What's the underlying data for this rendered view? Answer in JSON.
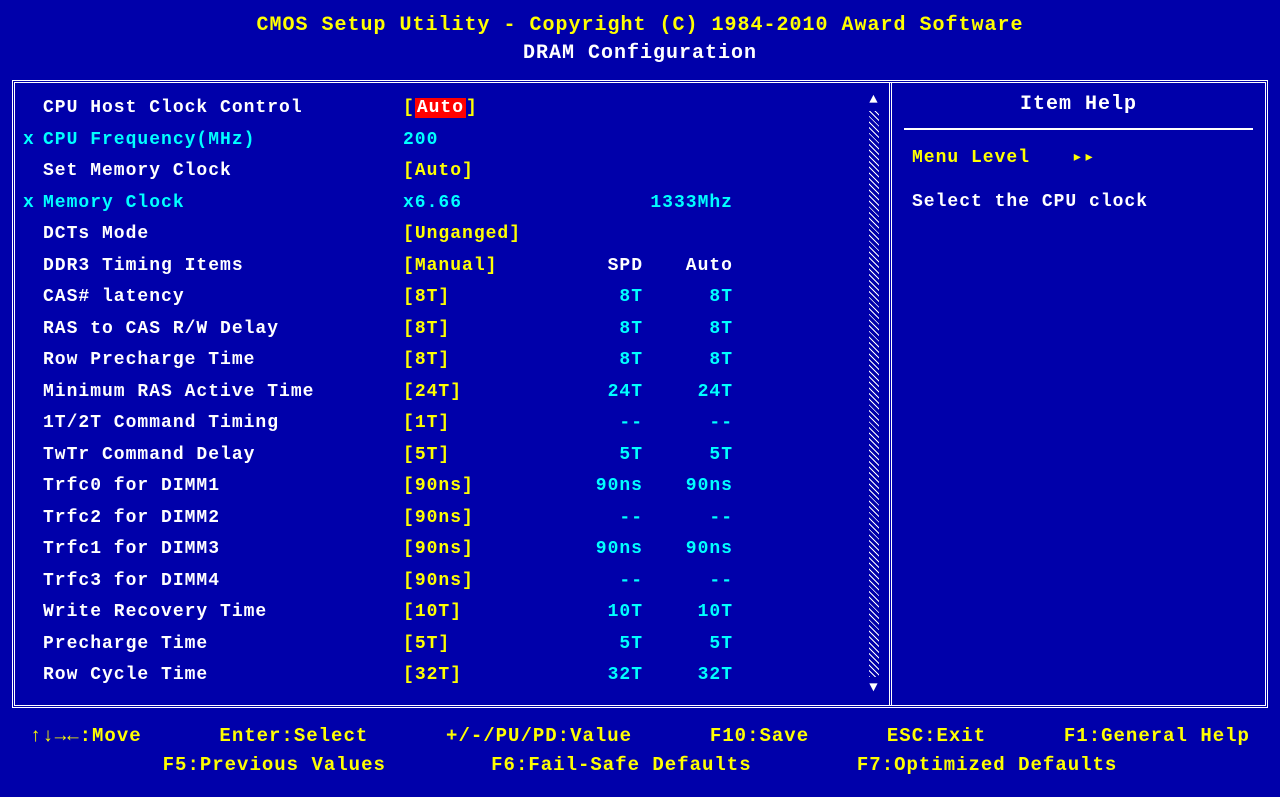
{
  "header": {
    "title1": "CMOS Setup Utility - Copyright (C) 1984-2010 Award Software",
    "title2": "DRAM Configuration"
  },
  "help": {
    "title": "Item Help",
    "menu_level_label": "Menu Level",
    "menu_level_arrows": "▸▸",
    "text": "Select the CPU clock"
  },
  "columns": {
    "spd": "SPD",
    "auto": "Auto"
  },
  "settings": [
    {
      "marker": "",
      "label": "CPU Host Clock Control",
      "value": "Auto",
      "bracketed": true,
      "highlight": true,
      "spd": "",
      "auto": "",
      "labelColor": "white",
      "valColor": "white"
    },
    {
      "marker": "x",
      "label": "CPU Frequency(MHz)",
      "value": "200",
      "bracketed": false,
      "highlight": false,
      "spd": "",
      "auto": "",
      "labelColor": "cyan",
      "valColor": "cyan"
    },
    {
      "marker": "",
      "label": "Set Memory Clock",
      "value": "Auto",
      "bracketed": true,
      "highlight": false,
      "spd": "",
      "auto": "",
      "labelColor": "white",
      "valColor": "yellow"
    },
    {
      "marker": "x",
      "label": "Memory Clock",
      "value": "x6.66",
      "bracketed": false,
      "highlight": false,
      "spd": "",
      "auto": "1333Mhz",
      "labelColor": "cyan",
      "valColor": "cyan"
    },
    {
      "marker": "",
      "label": "DCTs Mode",
      "value": "Unganged",
      "bracketed": true,
      "highlight": false,
      "spd": "",
      "auto": "",
      "labelColor": "white",
      "valColor": "yellow"
    },
    {
      "marker": "",
      "label": "DDR3 Timing Items",
      "value": "Manual",
      "bracketed": true,
      "highlight": false,
      "spd": "SPD",
      "auto": "Auto",
      "labelColor": "white",
      "valColor": "yellow",
      "header": true
    },
    {
      "marker": "",
      "label": "CAS# latency",
      "value": "8T",
      "bracketed": true,
      "highlight": false,
      "spd": "8T",
      "auto": "8T",
      "labelColor": "white",
      "valColor": "yellow"
    },
    {
      "marker": "",
      "label": "RAS to CAS R/W Delay",
      "value": "8T",
      "bracketed": true,
      "highlight": false,
      "spd": "8T",
      "auto": "8T",
      "labelColor": "white",
      "valColor": "yellow"
    },
    {
      "marker": "",
      "label": "Row Precharge Time",
      "value": "8T",
      "bracketed": true,
      "highlight": false,
      "spd": "8T",
      "auto": "8T",
      "labelColor": "white",
      "valColor": "yellow"
    },
    {
      "marker": "",
      "label": "Minimum RAS Active Time",
      "value": "24T",
      "bracketed": true,
      "highlight": false,
      "spd": "24T",
      "auto": "24T",
      "labelColor": "white",
      "valColor": "yellow"
    },
    {
      "marker": "",
      "label": "1T/2T Command Timing",
      "value": "1T",
      "bracketed": true,
      "highlight": false,
      "spd": "--",
      "auto": "--",
      "labelColor": "white",
      "valColor": "yellow"
    },
    {
      "marker": "",
      "label": "TwTr Command Delay",
      "value": "5T",
      "bracketed": true,
      "highlight": false,
      "spd": "5T",
      "auto": "5T",
      "labelColor": "white",
      "valColor": "yellow"
    },
    {
      "marker": "",
      "label": "Trfc0 for DIMM1",
      "value": "90ns",
      "bracketed": true,
      "highlight": false,
      "spd": "90ns",
      "auto": "90ns",
      "labelColor": "white",
      "valColor": "yellow"
    },
    {
      "marker": "",
      "label": "Trfc2 for DIMM2",
      "value": "90ns",
      "bracketed": true,
      "highlight": false,
      "spd": "--",
      "auto": "--",
      "labelColor": "white",
      "valColor": "yellow"
    },
    {
      "marker": "",
      "label": "Trfc1 for DIMM3",
      "value": "90ns",
      "bracketed": true,
      "highlight": false,
      "spd": "90ns",
      "auto": "90ns",
      "labelColor": "white",
      "valColor": "yellow"
    },
    {
      "marker": "",
      "label": "Trfc3 for DIMM4",
      "value": "90ns",
      "bracketed": true,
      "highlight": false,
      "spd": "--",
      "auto": "--",
      "labelColor": "white",
      "valColor": "yellow"
    },
    {
      "marker": "",
      "label": "Write Recovery Time",
      "value": "10T",
      "bracketed": true,
      "highlight": false,
      "spd": "10T",
      "auto": "10T",
      "labelColor": "white",
      "valColor": "yellow"
    },
    {
      "marker": "",
      "label": "Precharge Time",
      "value": "5T",
      "bracketed": true,
      "highlight": false,
      "spd": "5T",
      "auto": "5T",
      "labelColor": "white",
      "valColor": "yellow"
    },
    {
      "marker": "",
      "label": "Row Cycle Time",
      "value": "32T",
      "bracketed": true,
      "highlight": false,
      "spd": "32T",
      "auto": "32T",
      "labelColor": "white",
      "valColor": "yellow"
    }
  ],
  "footer": {
    "line1": {
      "move": "↑↓→←:Move",
      "select": "Enter:Select",
      "value": "+/-/PU/PD:Value",
      "save": "F10:Save",
      "exit": "ESC:Exit",
      "help": "F1:General Help"
    },
    "line2": {
      "prev": "F5:Previous Values",
      "failsafe": "F6:Fail-Safe Defaults",
      "optimized": "F7:Optimized Defaults"
    }
  }
}
